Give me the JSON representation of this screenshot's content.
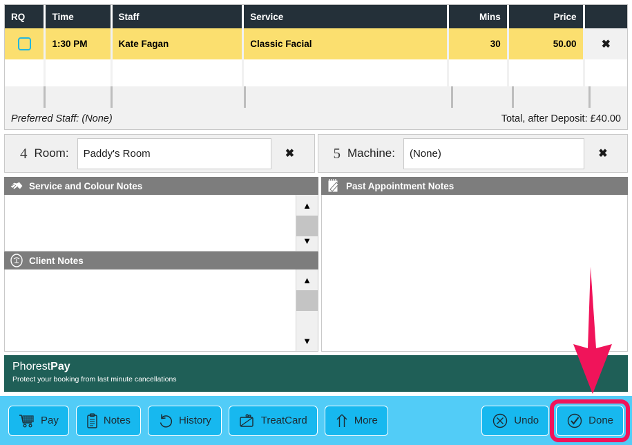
{
  "service_table": {
    "columns": [
      "RQ",
      "Time",
      "Staff",
      "Service",
      "Mins",
      "Price",
      ""
    ],
    "rows": [
      {
        "rq": "",
        "time": "1:30 PM",
        "staff": "Kate Fagan",
        "service": "Classic Facial",
        "mins": "30",
        "price": "50.00",
        "delete": "✖",
        "selected": true
      }
    ],
    "preferred_staff_label": "Preferred Staff:",
    "preferred_staff_value": "(None)",
    "total_label": "Total, after Deposit:",
    "total_value": "£40.00",
    "total_text": "Total, after Deposit: £40.00"
  },
  "room_row": {
    "number": "4",
    "label": "Room:",
    "value": "Paddy's Room",
    "placeholder": "",
    "clear": "✖"
  },
  "machine_row": {
    "number": "5",
    "label": "Machine:",
    "value": "(None)",
    "placeholder": "",
    "clear": "✖"
  },
  "notes": {
    "service_colour": {
      "title": "Service and Colour Notes",
      "icon": "hand-shake-icon",
      "content": ""
    },
    "client": {
      "title": "Client Notes",
      "icon": "client-head-icon",
      "content": ""
    },
    "past_appointment": {
      "title": "Past Appointment Notes",
      "icon": "notepad-pencil-icon",
      "content": ""
    },
    "scroll_up": "▲",
    "scroll_down": "▼"
  },
  "phorest_pay": {
    "brand_light": "Phorest",
    "brand_bold": "Pay",
    "tagline": "Protect your booking from last minute cancellations"
  },
  "action_bar": {
    "left_buttons": [
      {
        "label": "Pay",
        "icon": "shopping-cart-icon"
      },
      {
        "label": "Notes",
        "icon": "clipboard-icon"
      },
      {
        "label": "History",
        "icon": "undo-circle-icon"
      },
      {
        "label": "TreatCard",
        "icon": "gift-card-icon"
      },
      {
        "label": "More",
        "icon": "up-arrow-icon"
      }
    ],
    "right_buttons": [
      {
        "label": "Undo",
        "icon": "x-circle-icon"
      },
      {
        "label": "Done",
        "icon": "check-circle-icon"
      }
    ]
  },
  "annotation": {
    "arrow": "down-arrow-annotation",
    "highlight": "done-button-highlight"
  },
  "colors": {
    "header_navy": "#243039",
    "selected_row_yellow": "#fbdf6f",
    "checkbox_cyan": "#24b6df",
    "notes_header_grey": "#7d7d7d",
    "phorest_green": "#1f5f57",
    "action_bar_blue": "#52ccf7",
    "button_blue": "#17b8ef",
    "annotation_pink": "#f0145a"
  }
}
